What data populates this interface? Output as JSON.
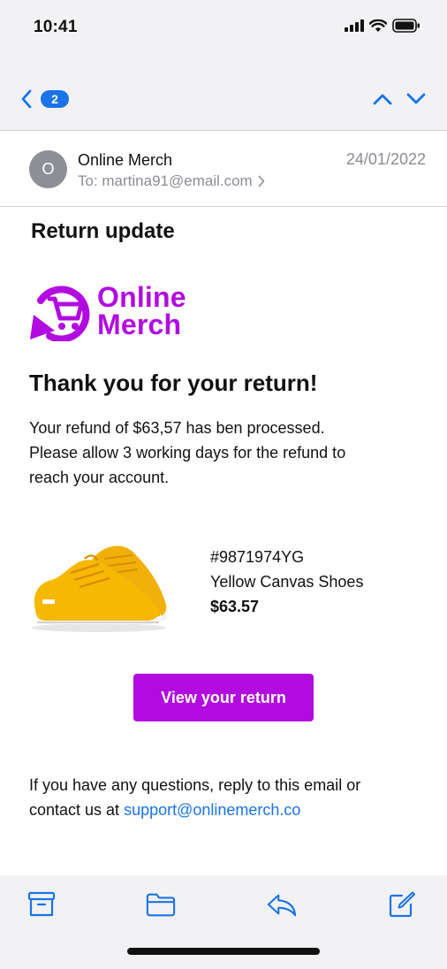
{
  "status_bar": {
    "time": "10:41"
  },
  "nav": {
    "badge_count": "2"
  },
  "email": {
    "avatar_initial": "O",
    "sender": "Online Merch",
    "recipient": "To: martina91@email.com",
    "date": "24/01/2022",
    "subject": "Return update"
  },
  "logo": {
    "line1": "Online",
    "line2": "Merch"
  },
  "content": {
    "headline": "Thank you for your return!",
    "paragraph_line1": "Your refund of $63,57 has ben processed.",
    "paragraph_line2": "Please allow 3 working days for the refund to",
    "paragraph_line3": "reach your account."
  },
  "product": {
    "order_number": "#9871974YG",
    "name": "Yellow Canvas Shoes",
    "price": "$63.57"
  },
  "cta": {
    "label": "View your return"
  },
  "footer": {
    "line1": "If you have any questions, reply to this email or",
    "line2_prefix": "contact us at ",
    "support_link": "support@onlinemerch.co"
  },
  "colors": {
    "brand": "#b10be0",
    "link": "#1a73e8",
    "muted": "#8c8c93"
  },
  "icons": {
    "toolbar": [
      "archive-icon",
      "folder-icon",
      "reply-icon",
      "compose-icon"
    ],
    "nav": [
      "chevron-left-icon",
      "chevron-up-icon",
      "chevron-down-icon"
    ]
  }
}
